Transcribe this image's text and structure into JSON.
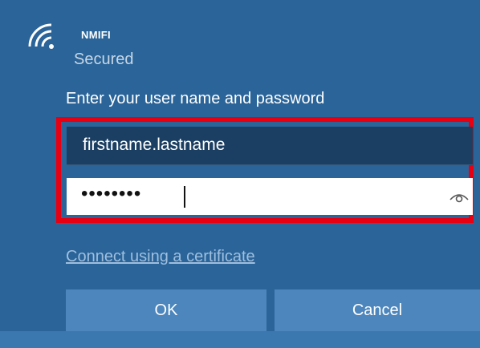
{
  "network": {
    "name": "NMIFI",
    "status": "Secured"
  },
  "form": {
    "prompt": "Enter your user name and password",
    "username_value": "firstname.lastname",
    "password_mask": "••••••••"
  },
  "links": {
    "certificate": "Connect using a certificate"
  },
  "buttons": {
    "ok": "OK",
    "cancel": "Cancel"
  },
  "colors": {
    "background": "#2a6499",
    "highlight_border": "#e60012",
    "button": "#4c86bd"
  },
  "icons": {
    "network": "wifi-icon",
    "reveal_password": "eye-icon"
  }
}
